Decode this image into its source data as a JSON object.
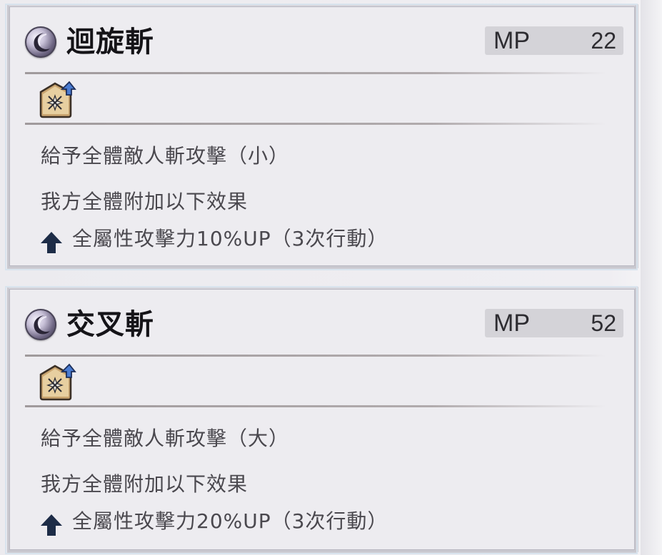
{
  "skills": [
    {
      "name": "迴旋斬",
      "mp_label": "MP",
      "mp_cost": "22",
      "attribute_icon": "slash-attribute-icon",
      "description_1": "給予全體敵人斬攻擊（小）",
      "description_2": "我方全體附加以下效果",
      "buff_icon": "up-arrow-icon",
      "buff_text": "全屬性攻擊力10%UP（3次行動）"
    },
    {
      "name": "交叉斬",
      "mp_label": "MP",
      "mp_cost": "52",
      "attribute_icon": "slash-attribute-icon",
      "description_1": "給予全體敵人斬攻擊（大）",
      "description_2": "我方全體附加以下效果",
      "buff_icon": "up-arrow-icon",
      "buff_text": "全屬性攻擊力20%UP（3次行動）"
    }
  ],
  "colors": {
    "card_bg": "#edecf0",
    "mp_box_bg": "#d4d3d8",
    "text_main": "#151418",
    "text_desc": "#4a484e",
    "buff_arrow": "#1d2c47"
  }
}
